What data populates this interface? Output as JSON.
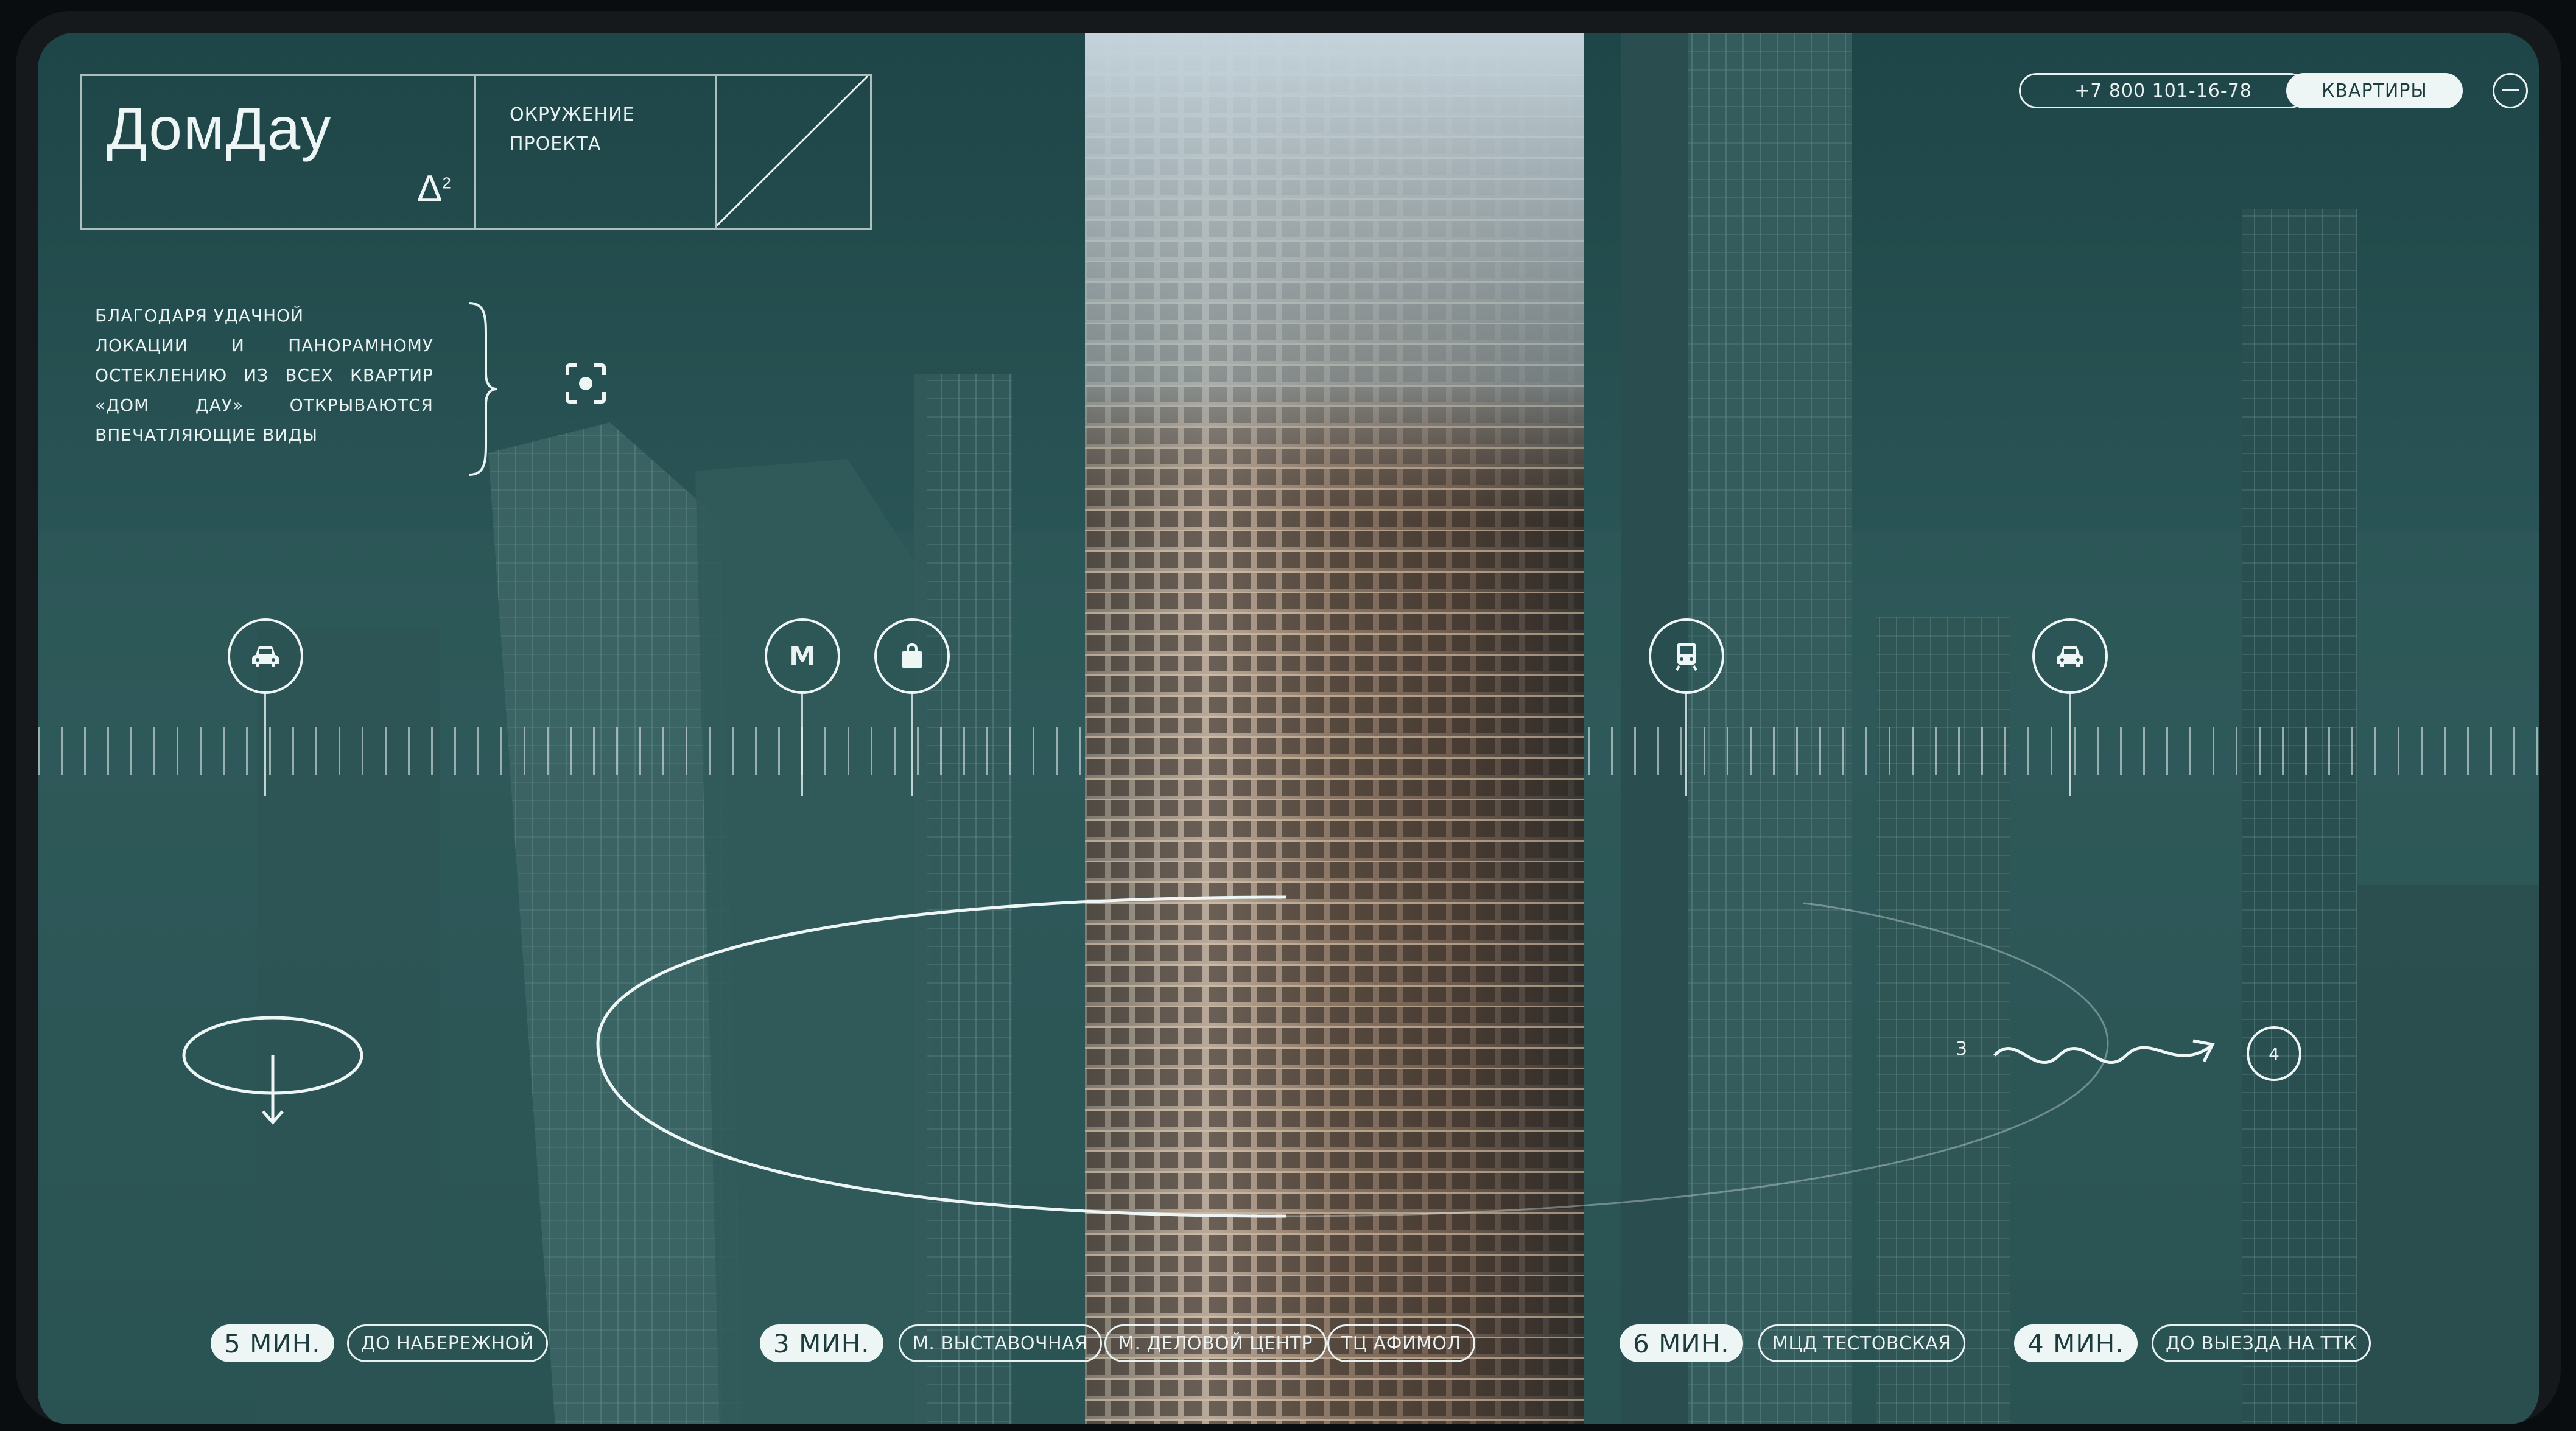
{
  "header": {
    "brand": "ДомДау",
    "brand_mark": "Δ",
    "brand_mark_sup": "2",
    "section_title": "ОКРУЖЕНИЕ ПРОЕКТА",
    "phone": "+7 800 101-16-78",
    "apartments_label": "КВАРТИРЫ"
  },
  "description": {
    "first_line": "БЛАГОДАРЯ УДАЧНОЙ",
    "rest": "ЛОКАЦИИ И ПАНОРАМНОМУ ОСТЕКЛЕНИЮ ИЗ ВСЕХ КВАРТИР «ДОМ ДАУ» ОТКРЫВАЮТСЯ ВПЕЧАТЛЯЮЩИЕ ВИДЫ"
  },
  "markers": [
    {
      "icon": "car-icon"
    },
    {
      "icon": "metro-icon",
      "letter": "M"
    },
    {
      "icon": "shopping-bag-icon"
    },
    {
      "icon": "train-icon"
    },
    {
      "icon": "car-icon"
    }
  ],
  "bottom": {
    "group1": {
      "time": "5 МИН.",
      "places": [
        "ДО НАБЕРЕЖНОЙ"
      ]
    },
    "group2": {
      "time": "3 МИН.",
      "places": [
        "М. ВЫСТАВОЧНАЯ",
        "М. ДЕЛОВОЙ ЦЕНТР",
        "ТЦ АФИМОЛ"
      ]
    },
    "group3": {
      "time": "6 МИН.",
      "places": [
        "МЦД ТЕСТОВСКАЯ"
      ]
    },
    "group4": {
      "time": "4 МИН.",
      "places": [
        "ДО ВЫЕЗДА НА ТТК"
      ]
    }
  },
  "pager": {
    "current": "3",
    "next": "4"
  },
  "colors": {
    "bg": "#2a5557",
    "accent": "#eef5f5",
    "dark_text": "#1c3c3e"
  }
}
